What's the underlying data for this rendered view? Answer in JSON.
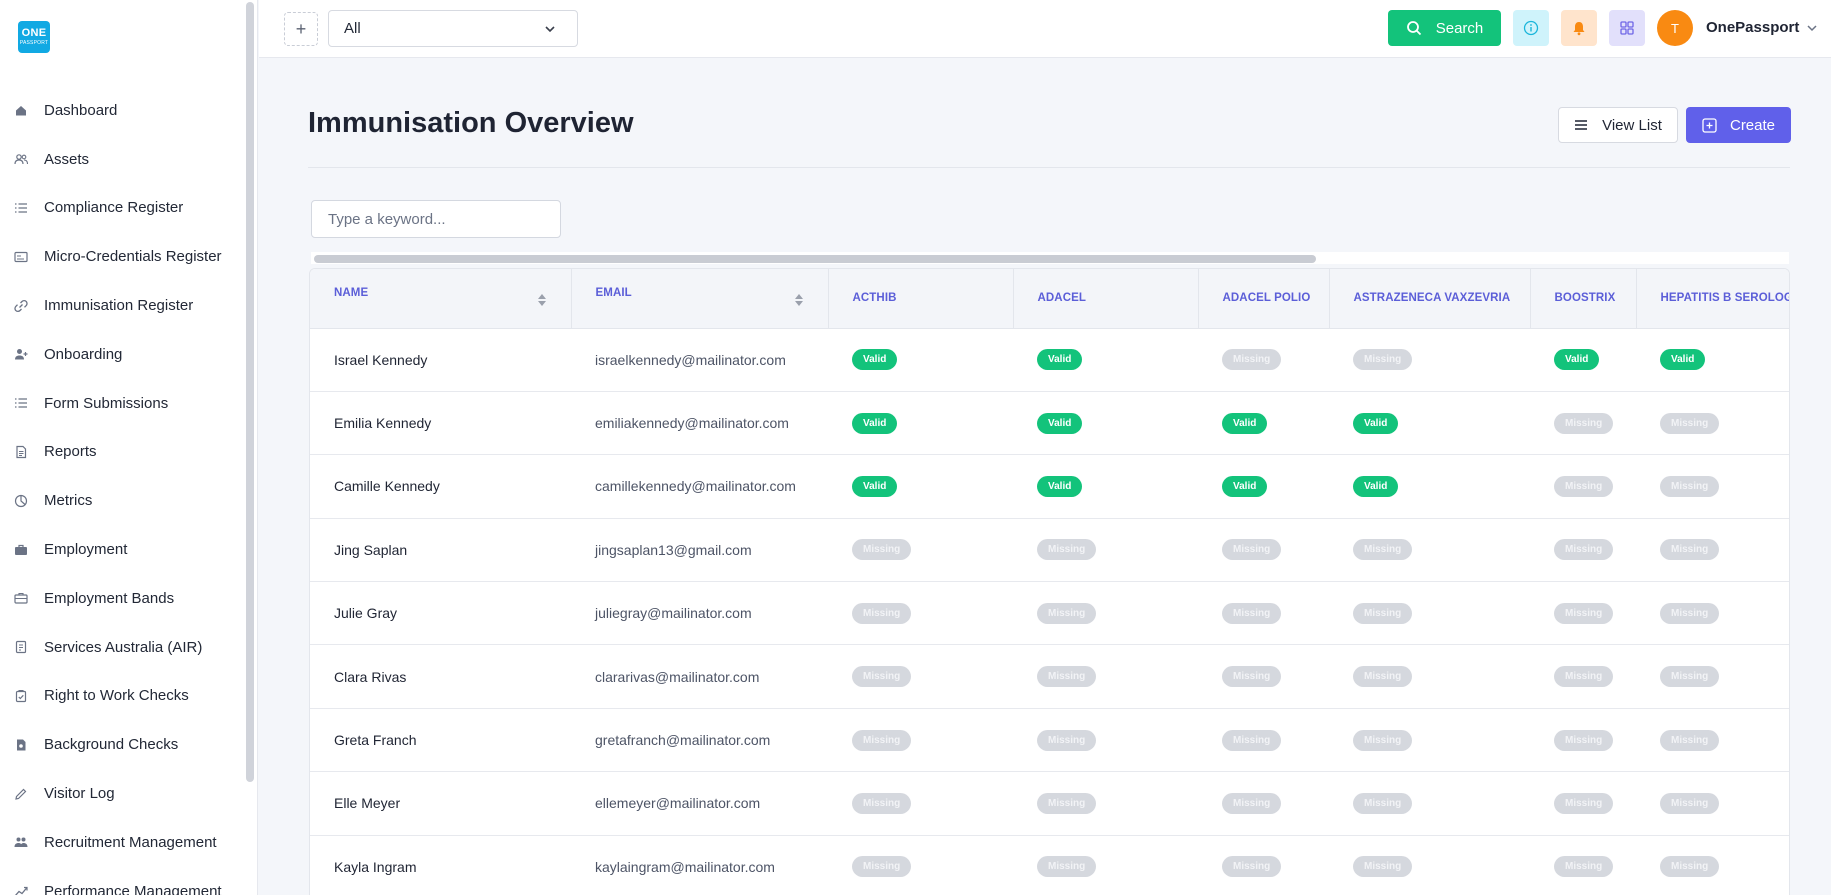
{
  "brand": {
    "logo_line1": "ONE",
    "logo_line2": "PASSPORT"
  },
  "sidebar": {
    "items": [
      {
        "label": "Dashboard",
        "icon": "home-icon"
      },
      {
        "label": "Assets",
        "icon": "users-icon"
      },
      {
        "label": "Compliance Register",
        "icon": "list-icon"
      },
      {
        "label": "Micro-Credentials Register",
        "icon": "card-icon"
      },
      {
        "label": "Immunisation Register",
        "icon": "link-icon"
      },
      {
        "label": "Onboarding",
        "icon": "user-plus-icon"
      },
      {
        "label": "Form Submissions",
        "icon": "list-icon"
      },
      {
        "label": "Reports",
        "icon": "document-icon"
      },
      {
        "label": "Metrics",
        "icon": "pie-chart-icon"
      },
      {
        "label": "Employment",
        "icon": "briefcase-icon"
      },
      {
        "label": "Employment Bands",
        "icon": "briefcase-outline-icon"
      },
      {
        "label": "Services Australia (AIR)",
        "icon": "file-icon"
      },
      {
        "label": "Right to Work Checks",
        "icon": "clipboard-check-icon"
      },
      {
        "label": "Background Checks",
        "icon": "file-shield-icon"
      },
      {
        "label": "Visitor Log",
        "icon": "pen-icon"
      },
      {
        "label": "Recruitment Management",
        "icon": "people-icon"
      },
      {
        "label": "Performance Management",
        "icon": "trend-icon"
      }
    ]
  },
  "topbar": {
    "scope_value": "All",
    "search_label": "Search",
    "avatar_initial": "T",
    "user_name": "OnePassport"
  },
  "page": {
    "title": "Immunisation Overview",
    "view_list_label": "View List",
    "create_label": "Create",
    "keyword_placeholder": "Type a keyword..."
  },
  "table": {
    "columns": [
      "NAME",
      "EMAIL",
      "ACTHIB",
      "ADACEL",
      "ADACEL POLIO",
      "ASTRAZENECA VAXZEVRIA",
      "BOOSTRIX",
      "HEPATITIS B SEROLOGY"
    ],
    "status_labels": {
      "valid": "Valid",
      "missing": "Missing"
    },
    "rows": [
      {
        "name": "Israel Kennedy",
        "email": "israelkennedy@mailinator.com",
        "statuses": [
          "valid",
          "valid",
          "missing",
          "missing",
          "valid",
          "valid"
        ]
      },
      {
        "name": "Emilia Kennedy",
        "email": "emiliakennedy@mailinator.com",
        "statuses": [
          "valid",
          "valid",
          "valid",
          "valid",
          "missing",
          "missing"
        ]
      },
      {
        "name": "Camille Kennedy",
        "email": "camillekennedy@mailinator.com",
        "statuses": [
          "valid",
          "valid",
          "valid",
          "valid",
          "missing",
          "missing"
        ]
      },
      {
        "name": "Jing Saplan",
        "email": "jingsaplan13@gmail.com",
        "statuses": [
          "missing",
          "missing",
          "missing",
          "missing",
          "missing",
          "missing"
        ]
      },
      {
        "name": "Julie Gray",
        "email": "juliegray@mailinator.com",
        "statuses": [
          "missing",
          "missing",
          "missing",
          "missing",
          "missing",
          "missing"
        ]
      },
      {
        "name": "Clara Rivas",
        "email": "clararivas@mailinator.com",
        "statuses": [
          "missing",
          "missing",
          "missing",
          "missing",
          "missing",
          "missing"
        ]
      },
      {
        "name": "Greta Franch",
        "email": "gretafranch@mailinator.com",
        "statuses": [
          "missing",
          "missing",
          "missing",
          "missing",
          "missing",
          "missing"
        ]
      },
      {
        "name": "Elle Meyer",
        "email": "ellemeyer@mailinator.com",
        "statuses": [
          "missing",
          "missing",
          "missing",
          "missing",
          "missing",
          "missing"
        ]
      },
      {
        "name": "Kayla Ingram",
        "email": "kaylaingram@mailinator.com",
        "statuses": [
          "missing",
          "missing",
          "missing",
          "missing",
          "missing",
          "missing"
        ]
      }
    ]
  },
  "colors": {
    "valid": "#13c37b",
    "missing": "#d5d8de",
    "accent": "#6060ea",
    "search": "#13c37b"
  }
}
